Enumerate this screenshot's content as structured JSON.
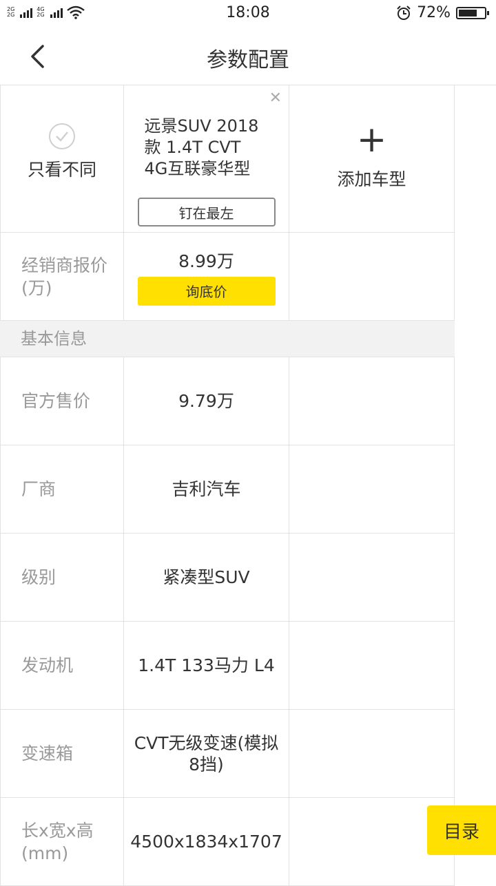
{
  "status": {
    "network_top": "2G",
    "network_mid": "4G",
    "network_bot": "2G",
    "time": "18:08",
    "battery": "72%",
    "battery_level": 0.72
  },
  "nav": {
    "title": "参数配置"
  },
  "compare": {
    "only_diff_label": "只看不同",
    "car_name": "远景SUV 2018款 1.4T CVT 4G互联豪华型",
    "pin_label": "钉在最左",
    "add_label": "添加车型"
  },
  "dealer": {
    "label": "经销商报价(万)",
    "price": "8.99万",
    "inquire_label": "询底价"
  },
  "section": {
    "basic": "基本信息"
  },
  "rows": [
    {
      "label": "官方售价",
      "value": "9.79万"
    },
    {
      "label": "厂商",
      "value": "吉利汽车"
    },
    {
      "label": "级别",
      "value": "紧凑型SUV"
    },
    {
      "label": "发动机",
      "value": "1.4T 133马力 L4"
    },
    {
      "label": "变速箱",
      "value": "CVT无级变速(模拟8挡)"
    },
    {
      "label": "长x宽x高(mm)",
      "value": "4500x1834x1707"
    }
  ],
  "catalog_label": "目录"
}
